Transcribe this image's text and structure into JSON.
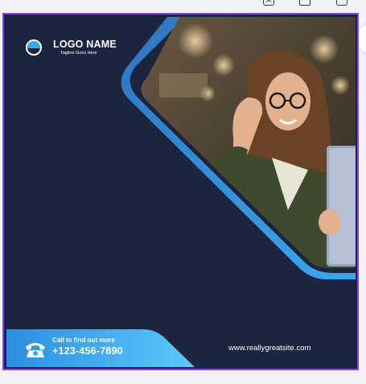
{
  "toolbar": {
    "icons": [
      "export-up-icon",
      "duplicate-page-icon",
      "add-page-icon"
    ]
  },
  "design": {
    "logo": {
      "name": "LOGO NAME",
      "tagline": "Tagline Goes Here",
      "icon": "circle-logo-icon"
    },
    "contact": {
      "label": "Call to find out more",
      "phone": "+123-456-7890",
      "icon": "telephone-icon"
    },
    "website": "www.reallygreatsite.com",
    "photo": {
      "description_icon": "woman-with-glasses-holding-laptop"
    }
  },
  "colors": {
    "background": "#1b2540",
    "accent_blue": "#3ba7ee",
    "accent_blue_light": "#5cc0f7",
    "selection_border": "#8b3dff"
  }
}
